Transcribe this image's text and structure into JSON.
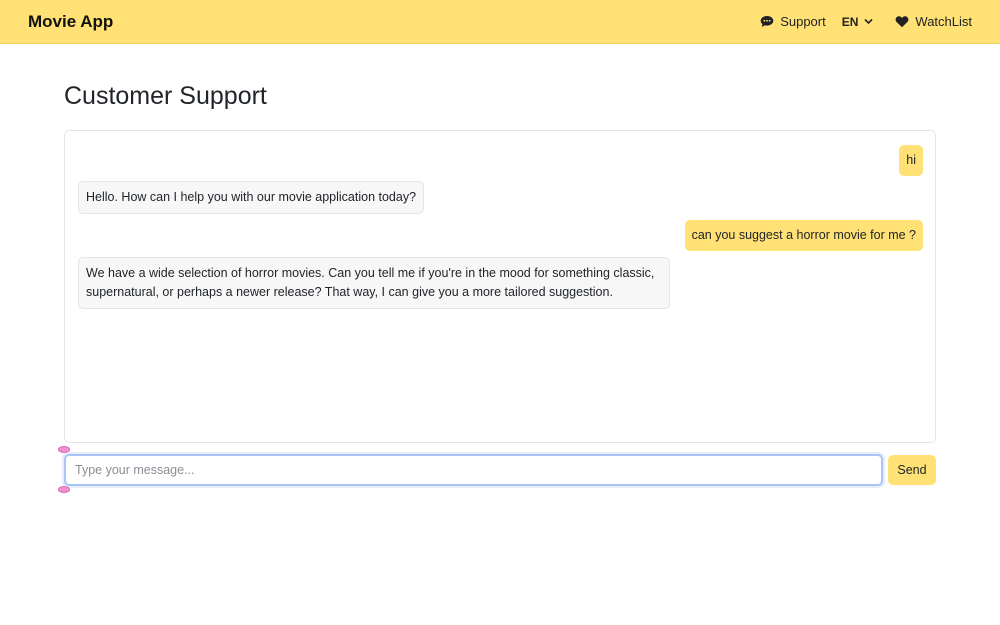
{
  "navbar": {
    "brand": "Movie App",
    "support_label": "Support",
    "support_icon": "chat-bubble-icon",
    "language_label": "EN",
    "language_icon": "chevron-down-icon",
    "watchlist_label": "WatchList",
    "watchlist_icon": "heart-icon"
  },
  "page": {
    "title": "Customer Support"
  },
  "chat": {
    "messages": [
      {
        "sender": "user",
        "text": "hi"
      },
      {
        "sender": "bot",
        "text": "Hello. How can I help you with our movie application today?"
      },
      {
        "sender": "user",
        "text": "can you suggest a horror movie for me ?"
      },
      {
        "sender": "bot",
        "text": "We have a wide selection of horror movies. Can you tell me if you're in the mood for something classic, supernatural, or perhaps a newer release? That way, I can give you a more tailored suggestion."
      }
    ]
  },
  "composer": {
    "placeholder": "Type your message...",
    "value": "",
    "send_label": "Send"
  },
  "colors": {
    "accent": "#ffe175",
    "bot_bubble": "#f7f7f8",
    "input_focus": "#a9c5f5"
  }
}
